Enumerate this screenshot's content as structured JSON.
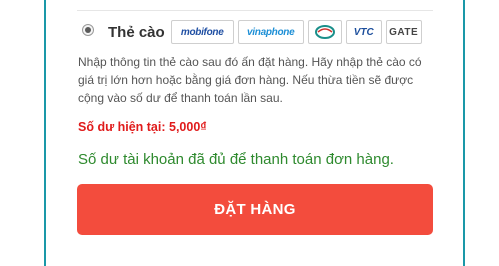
{
  "payment_method": {
    "label": "Thẻ cào",
    "selected": true,
    "logos": [
      {
        "name": "mobifone",
        "text": "mobifone"
      },
      {
        "name": "vinaphone",
        "text": "vinaphone"
      },
      {
        "name": "viettel",
        "text": ""
      },
      {
        "name": "vtc",
        "text": "VTC"
      },
      {
        "name": "gate",
        "text": "GATE"
      }
    ]
  },
  "instructions": "Nhập thông tin thẻ cào sau đó ấn đặt hàng. Hãy nhập thẻ cào có giá trị lớn hơn hoặc bằng giá đơn hàng. Nếu thừa tiền sẽ được cộng vào số dư để thanh toán lần sau.",
  "balance": "Số dư hiện tại: 5,000₫",
  "status_message": "Số dư tài khoản đã đủ để thanh toán đơn hàng.",
  "order_button_label": "ĐẶT HÀNG",
  "colors": {
    "frame": "#1a98a8",
    "button": "#f34c3d",
    "balance": "#e01b1b",
    "status": "#2e8a2e"
  }
}
